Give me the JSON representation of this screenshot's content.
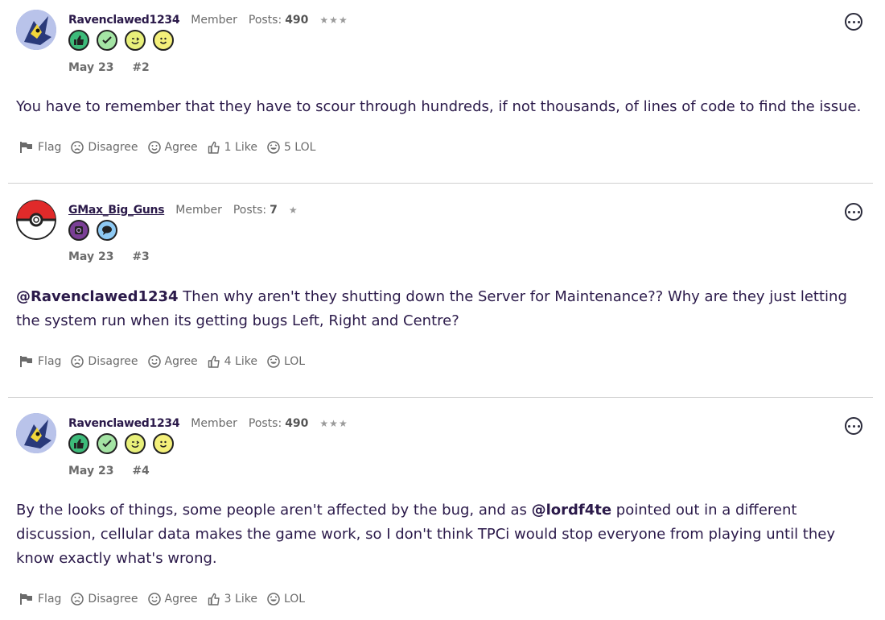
{
  "posts": [
    {
      "username": "Ravenclawed1234",
      "role": "Member",
      "posts_label": "Posts:",
      "posts_count": "490",
      "stars": "★★★",
      "date": "May 23",
      "number": "#2",
      "body_text": "You have to remember that they have to scour through hundreds, if not thousands, of lines of code to find the issue.",
      "actions": {
        "flag": "Flag",
        "disagree": "Disagree",
        "agree": "Agree",
        "like": "1 Like",
        "lol": "5 LOL"
      }
    },
    {
      "username": "GMax_Big_Guns",
      "role": "Member",
      "posts_label": "Posts:",
      "posts_count": "7",
      "stars": "★",
      "date": "May 23",
      "number": "#3",
      "mention": "@Ravenclawed1234",
      "body_text": " Then why aren't they shutting down the Server for Maintenance?? Why are they just letting the system run when its getting bugs Left, Right and Centre?",
      "actions": {
        "flag": "Flag",
        "disagree": "Disagree",
        "agree": "Agree",
        "like": "4 Like",
        "lol": "LOL"
      }
    },
    {
      "username": "Ravenclawed1234",
      "role": "Member",
      "posts_label": "Posts:",
      "posts_count": "490",
      "stars": "★★★",
      "date": "May 23",
      "number": "#4",
      "body_before": "By the looks of things, some people aren't affected by the bug, and as ",
      "mention": "@lordf4te",
      "body_after": " pointed out in a different discussion, cellular data makes the game work, so I don't think TPCi would stop everyone from playing until they know exactly what's wrong.",
      "actions": {
        "flag": "Flag",
        "disagree": "Disagree",
        "agree": "Agree",
        "like": "3 Like",
        "lol": "LOL"
      }
    }
  ],
  "icons": {
    "avatar_1": "dragon-pokemon-avatar",
    "avatar_2": "pokeball-avatar",
    "badges_1": [
      "thumbs-up-badge",
      "checkmark-badge",
      "wink-badge",
      "smile-badge"
    ],
    "badges_2": [
      "camera-badge",
      "speech-bubble-badge"
    ],
    "more": "more-options-icon"
  },
  "colors": {
    "text": "#2b1a4a",
    "muted": "#6b6b6b",
    "divider": "#cfcfcf"
  }
}
